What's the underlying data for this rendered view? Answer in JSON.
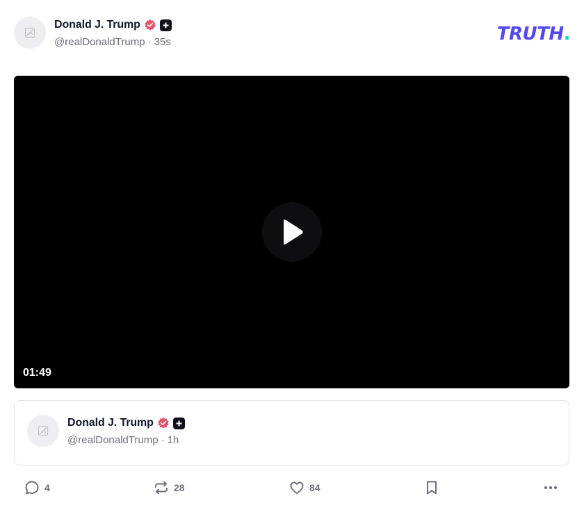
{
  "post": {
    "author_name": "Donald J. Trump",
    "handle": "@realDonaldTrump",
    "separator": "·",
    "time": "35s"
  },
  "brand": {
    "text": "TRUTH",
    "dot": ".",
    "color": "#5448ee",
    "accent": "#1ad1c5"
  },
  "video": {
    "duration": "01:49"
  },
  "quoted_post": {
    "author_name": "Donald J. Trump",
    "handle": "@realDonaldTrump",
    "separator": "·",
    "time": "1h"
  },
  "actions": {
    "replies": "4",
    "retruths": "28",
    "likes": "84"
  },
  "icons": {
    "verified": "verified-badge-icon",
    "plus": "plus-badge-icon",
    "avatar": "image-placeholder-icon",
    "play": "play-icon",
    "reply": "reply-icon",
    "retruth": "retruth-icon",
    "like": "heart-icon",
    "bookmark": "bookmark-icon",
    "more": "more-icon"
  }
}
